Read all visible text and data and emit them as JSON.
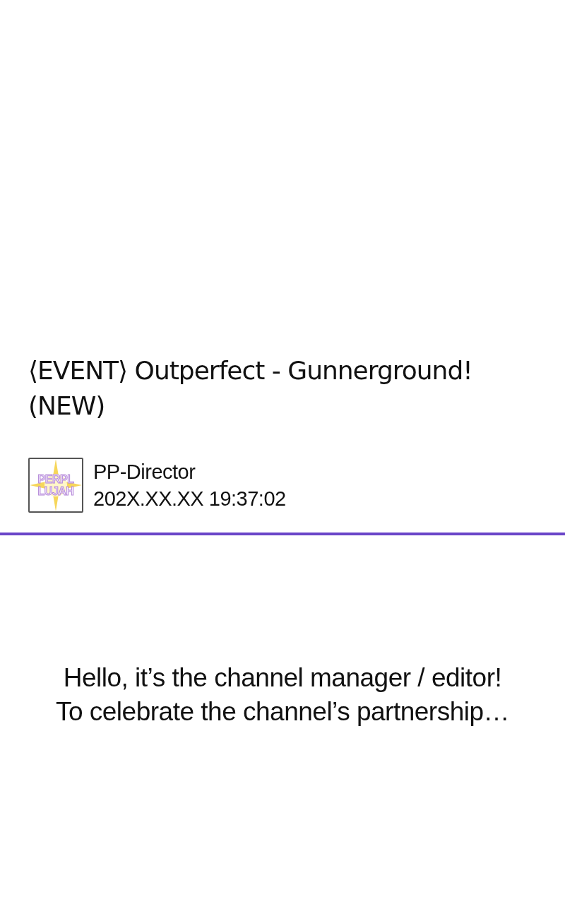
{
  "post": {
    "title": "⟨EVENT⟩ Outperfect - Gunnerground! (NEW)",
    "author": {
      "avatar": {
        "lines": [
          "PERPL",
          "LUJAH"
        ]
      },
      "name": "PP-Director",
      "timestamp": "202X.XX.XX 19:37:02"
    },
    "body": [
      "Hello, it’s the channel manager / editor!",
      "To celebrate the channel’s partnership…"
    ]
  }
}
